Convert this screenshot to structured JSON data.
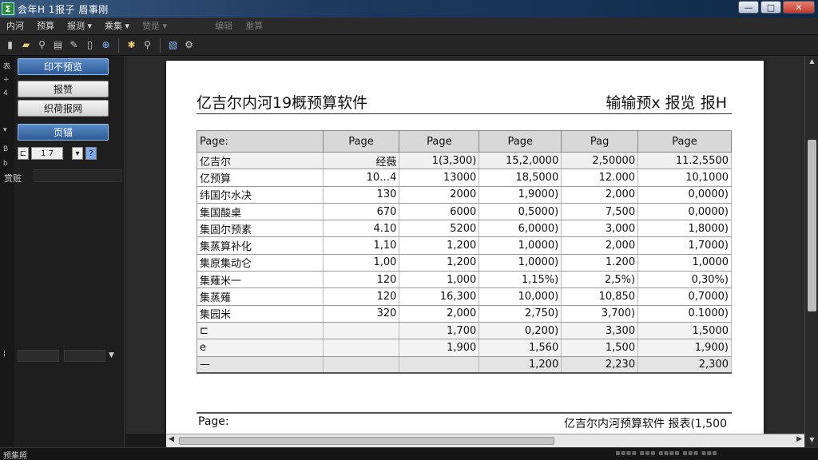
{
  "window": {
    "title": "会年H 1报子 眉事刚",
    "minimize": "—",
    "maximize": "□",
    "close": "✕"
  },
  "menu": [
    "内河",
    "预算",
    "报测 ▾",
    "乘集 ▾",
    "赞是 ▾",
    "编辑",
    "重算"
  ],
  "left_pane": {
    "btn_print": "印不预览",
    "btn_report": "报赞",
    "btn_format": "织荷报网",
    "btn_page": "页锚",
    "mini_a": "⊏",
    "mini_b": "1 7",
    "mini_c": "▾",
    "mini_d": "?",
    "field_label": "赏赃",
    "gutter": [
      "表",
      "+",
      "4",
      "▾",
      "B",
      "b",
      "¦"
    ]
  },
  "report": {
    "title_left": "亿吉尔内河19概预算软件",
    "title_right": "输输预x 报览 报H",
    "headers": [
      "Page:",
      "Page",
      "Page",
      "Page",
      "Pag",
      "Page"
    ],
    "rows": [
      [
        "亿吉尔",
        "经薇",
        "1(3,300)",
        "15,2,0000",
        "2,50000",
        "11.2,5500"
      ],
      [
        "亿预算",
        "10…4",
        "13000",
        "18,5000",
        "12.000",
        "10,1000"
      ],
      [
        "纬国尔水决",
        "130",
        "2000",
        "1,9000)",
        "2,000",
        "0,0000)"
      ],
      [
        "集国酸桌",
        "670",
        "6000",
        "0,5000)",
        "7,500",
        "0,0000)"
      ],
      [
        "集固尔预素",
        "4.10",
        "5200",
        "6,0000)",
        "3,000",
        "1,8000)"
      ],
      [
        "集蒸算补化",
        "1,10",
        "1,200",
        "1,0000)",
        "2,000",
        "1,7000)"
      ],
      [
        "集原集动仑",
        "1,00",
        "1,200",
        "1,0000)",
        "1.200",
        "1,0000"
      ],
      [
        "集薙米一",
        "120",
        "1,000",
        "1,15%)",
        "2,5%)",
        "0,30%)"
      ],
      [
        "集蒸薙",
        "120",
        "16,300",
        "10,000)",
        "10,850",
        "0,7000)"
      ],
      [
        "集园米",
        "320",
        "2,000",
        "2,750)",
        "3,700)",
        "0.1000)"
      ],
      [
        "⊏",
        "",
        "1,700",
        "0,200)",
        "3,300",
        "1,5000"
      ],
      [
        "e",
        "",
        "1,900",
        "1,560",
        "1,500",
        "1,900)"
      ],
      [
        "—",
        "",
        "",
        "1,200",
        "2,230",
        "2,300"
      ]
    ],
    "footer_left": "Page:",
    "footer_right": "亿吉尔内河预算软件  报表(1,500"
  },
  "status": {
    "left": "预集照",
    "right": "▪▪▪▪ ▪▪▪ ▪▪▪▪ ▪▪▪ ▪▪▪"
  }
}
